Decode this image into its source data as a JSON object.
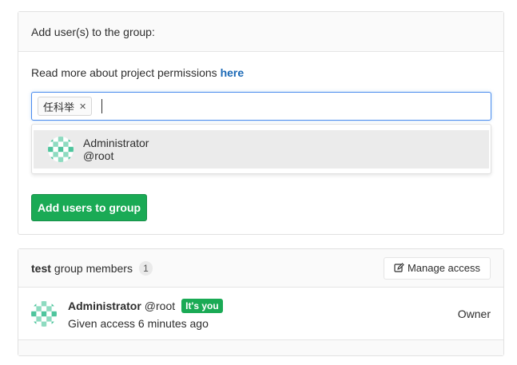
{
  "add_panel": {
    "heading": "Add user(s) to the group:",
    "permissions_text": "Read more about project permissions ",
    "permissions_link": "here",
    "token": "任科举",
    "dropdown": {
      "name": "Administrator",
      "username": "@root"
    },
    "submit_label": "Add users to group"
  },
  "members_panel": {
    "group_name": "test",
    "title_rest": "group members",
    "count": "1",
    "manage_label": "Manage access",
    "member": {
      "name": "Administrator",
      "username": "@root",
      "badge": "It's you",
      "access": "Given access 6 minutes ago",
      "role": "Owner"
    }
  },
  "colors": {
    "accent_link": "#1b69b6",
    "success": "#1aaa55",
    "avatar_primary": "#4fc59d",
    "avatar_secondary": "#8edbc0"
  },
  "icons": {
    "token_remove": "close-icon",
    "manage": "edit-icon",
    "avatar": "identicon"
  }
}
